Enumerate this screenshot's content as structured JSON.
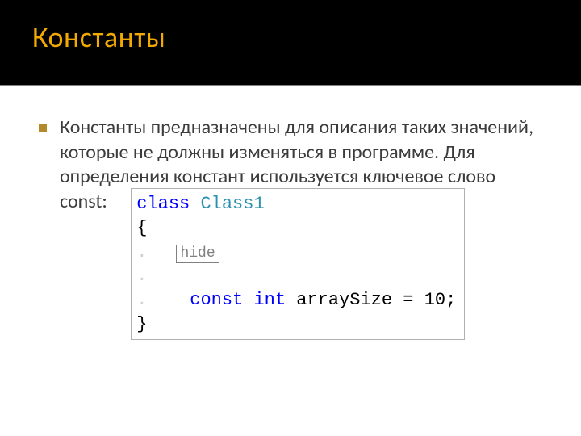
{
  "header": {
    "title": "Константы"
  },
  "content": {
    "paragraph": "Константы предназначены для описания таких значений, которые не должны изменяться в программе. Для определения констант используется ключевое слово",
    "const_word": "const:"
  },
  "code": {
    "kw_class": "class",
    "class_name": "Class1",
    "brace_open": "{",
    "hide_label": "hide",
    "kw_const": "const",
    "kw_int": "int",
    "var_decl": "arraySize = 10;",
    "brace_close": "}"
  }
}
